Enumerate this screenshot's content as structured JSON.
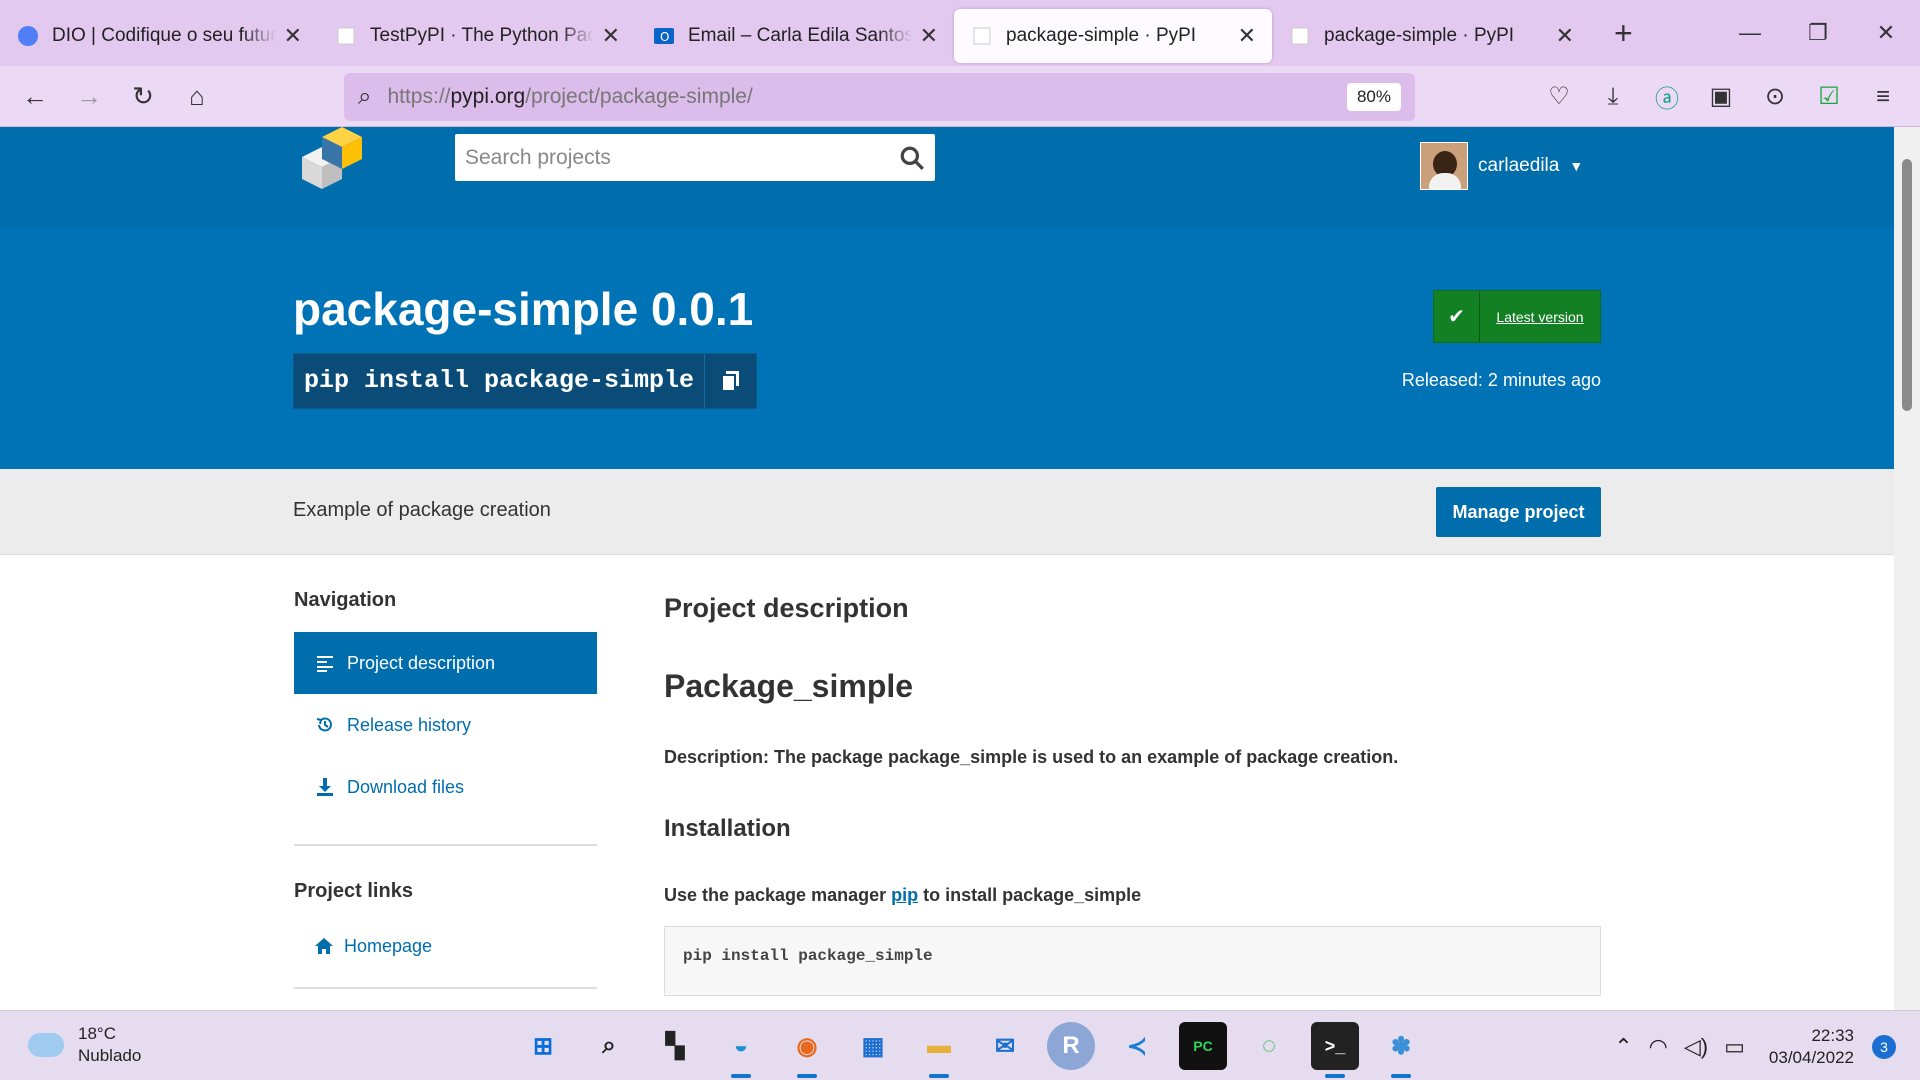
{
  "browser": {
    "tabs": [
      {
        "title": "DIO | Codifique o seu futuro g",
        "icon": "dio-icon"
      },
      {
        "title": "TestPyPI · The Python Package",
        "icon": "pypi-icon"
      },
      {
        "title": "Email – Carla Edila Santos da",
        "icon": "outlook-icon"
      },
      {
        "title": "package-simple · PyPI",
        "icon": "pypi-icon"
      },
      {
        "title": "package-simple · PyPI",
        "icon": "pypi-icon"
      }
    ],
    "active_tab": 3,
    "url_prefix": "https://",
    "url_domain": "pypi.org",
    "url_path": "/project/package-simple/",
    "zoom": "80%"
  },
  "pypi": {
    "search_placeholder": "Search projects",
    "username": "carlaedila",
    "package_title": "package-simple 0.0.1",
    "pip_command": "pip install package-simple",
    "latest_version_label": "Latest version",
    "released": "Released: 2 minutes ago",
    "summary": "Example of package creation",
    "manage_button": "Manage project",
    "nav_heading": "Navigation",
    "nav_items": [
      "Project description",
      "Release history",
      "Download files"
    ],
    "links_heading": "Project links",
    "links": [
      "Homepage"
    ],
    "content": {
      "heading": "Project description",
      "readme_title": "Package_simple",
      "description": "Description: The package package_simple is used to an example of package creation.",
      "installation_heading": "Installation",
      "use_prefix": "Use the package manager ",
      "use_link": "pip",
      "use_suffix": " to install package_simple",
      "code": "pip install package_simple"
    }
  },
  "taskbar": {
    "temperature": "18°C",
    "weather": "Nublado",
    "time": "22:33",
    "date": "03/04/2022",
    "notifications": "3"
  },
  "colors": {
    "pypi_blue": "#006dad",
    "hero_blue": "#0073b7",
    "green": "#148024"
  }
}
